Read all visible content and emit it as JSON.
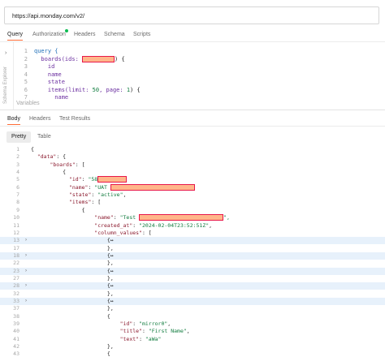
{
  "url": "https://api.monday.com/v2/",
  "request_tabs": [
    "Query",
    "Authorization",
    "Headers",
    "Schema",
    "Scripts"
  ],
  "schema_explorer_label": "Schema Explorer",
  "query": {
    "lines": [
      {
        "n": "1",
        "parts": [
          {
            "t": "query {",
            "c": "kw"
          }
        ]
      },
      {
        "n": "2",
        "parts": [
          {
            "t": "  boards(ids: ",
            "c": "fld"
          },
          {
            "t": "",
            "c": "redact",
            "w": 40
          },
          {
            "t": ") {",
            "c": "pun"
          }
        ]
      },
      {
        "n": "3",
        "parts": [
          {
            "t": "    id",
            "c": "fld"
          }
        ]
      },
      {
        "n": "4",
        "parts": [
          {
            "t": "    name",
            "c": "fld"
          }
        ]
      },
      {
        "n": "5",
        "parts": [
          {
            "t": "    state",
            "c": "fld"
          }
        ]
      },
      {
        "n": "6",
        "parts": [
          {
            "t": "    items(limit: ",
            "c": "fld"
          },
          {
            "t": "50",
            "c": "num"
          },
          {
            "t": ", page: ",
            "c": "fld"
          },
          {
            "t": "1",
            "c": "num"
          },
          {
            "t": ") {",
            "c": "pun"
          }
        ]
      },
      {
        "n": "7",
        "parts": [
          {
            "t": "      name",
            "c": "fld"
          }
        ]
      }
    ],
    "variables_label": "Variables"
  },
  "response_tabs": [
    "Body",
    "Headers",
    "Test Results"
  ],
  "view_tabs": [
    "Pretty",
    "Table"
  ],
  "response": {
    "rows": [
      {
        "n": "1",
        "a": "",
        "hl": false,
        "parts": [
          {
            "t": "{",
            "c": "pun"
          }
        ]
      },
      {
        "n": "2",
        "a": "",
        "hl": false,
        "parts": [
          {
            "t": "  ",
            "c": "pun"
          },
          {
            "t": "\"data\"",
            "c": "key"
          },
          {
            "t": ": {",
            "c": "pun"
          }
        ]
      },
      {
        "n": "3",
        "a": "",
        "hl": false,
        "parts": [
          {
            "t": "      ",
            "c": "pun"
          },
          {
            "t": "\"boards\"",
            "c": "key"
          },
          {
            "t": ": [",
            "c": "pun"
          }
        ]
      },
      {
        "n": "4",
        "a": "",
        "hl": false,
        "parts": [
          {
            "t": "          {",
            "c": "pun"
          }
        ]
      },
      {
        "n": "5",
        "a": "",
        "hl": false,
        "parts": [
          {
            "t": "            ",
            "c": "pun"
          },
          {
            "t": "\"id\"",
            "c": "key"
          },
          {
            "t": ": ",
            "c": "pun"
          },
          {
            "t": "\"58",
            "c": "str"
          },
          {
            "t": "",
            "c": "redact",
            "w": 36
          }
        ]
      },
      {
        "n": "6",
        "a": "",
        "hl": false,
        "parts": [
          {
            "t": "            ",
            "c": "pun"
          },
          {
            "t": "\"name\"",
            "c": "key"
          },
          {
            "t": ": ",
            "c": "pun"
          },
          {
            "t": "\"UAT",
            "c": "str"
          },
          {
            "t": " ",
            "c": "pun"
          },
          {
            "t": "",
            "c": "redact",
            "w": 104
          }
        ]
      },
      {
        "n": "7",
        "a": "",
        "hl": false,
        "parts": [
          {
            "t": "            ",
            "c": "pun"
          },
          {
            "t": "\"state\"",
            "c": "key"
          },
          {
            "t": ": ",
            "c": "pun"
          },
          {
            "t": "\"active\"",
            "c": "str"
          },
          {
            "t": ",",
            "c": "pun"
          }
        ]
      },
      {
        "n": "8",
        "a": "",
        "hl": false,
        "parts": [
          {
            "t": "            ",
            "c": "pun"
          },
          {
            "t": "\"items\"",
            "c": "key"
          },
          {
            "t": ": [",
            "c": "pun"
          }
        ]
      },
      {
        "n": "9",
        "a": "",
        "hl": false,
        "parts": [
          {
            "t": "                {",
            "c": "pun"
          }
        ]
      },
      {
        "n": "10",
        "a": "",
        "hl": false,
        "parts": [
          {
            "t": "                    ",
            "c": "pun"
          },
          {
            "t": "\"name\"",
            "c": "key"
          },
          {
            "t": ": ",
            "c": "pun"
          },
          {
            "t": "\"Test ",
            "c": "str"
          },
          {
            "t": "",
            "c": "redact",
            "w": 104
          },
          {
            "t": "\",",
            "c": "str"
          }
        ]
      },
      {
        "n": "11",
        "a": "",
        "hl": false,
        "parts": [
          {
            "t": "                    ",
            "c": "pun"
          },
          {
            "t": "\"created_at\"",
            "c": "key"
          },
          {
            "t": ": ",
            "c": "pun"
          },
          {
            "t": "\"2024-02-04T23:52:51Z\"",
            "c": "str"
          },
          {
            "t": ",",
            "c": "pun"
          }
        ]
      },
      {
        "n": "12",
        "a": "",
        "hl": false,
        "parts": [
          {
            "t": "                    ",
            "c": "pun"
          },
          {
            "t": "\"column_values\"",
            "c": "key"
          },
          {
            "t": ": [",
            "c": "pun"
          }
        ]
      },
      {
        "n": "13",
        "a": "›",
        "hl": true,
        "parts": [
          {
            "t": "                        {↔",
            "c": "pun"
          }
        ]
      },
      {
        "n": "17",
        "a": "",
        "hl": false,
        "parts": [
          {
            "t": "                        },",
            "c": "pun"
          }
        ]
      },
      {
        "n": "18",
        "a": "›",
        "hl": true,
        "parts": [
          {
            "t": "                        {↔",
            "c": "pun"
          }
        ]
      },
      {
        "n": "22",
        "a": "",
        "hl": false,
        "parts": [
          {
            "t": "                        },",
            "c": "pun"
          }
        ]
      },
      {
        "n": "23",
        "a": "›",
        "hl": true,
        "parts": [
          {
            "t": "                        {↔",
            "c": "pun"
          }
        ]
      },
      {
        "n": "27",
        "a": "",
        "hl": false,
        "parts": [
          {
            "t": "                        },",
            "c": "pun"
          }
        ]
      },
      {
        "n": "28",
        "a": "›",
        "hl": true,
        "parts": [
          {
            "t": "                        {↔",
            "c": "pun"
          }
        ]
      },
      {
        "n": "32",
        "a": "",
        "hl": false,
        "parts": [
          {
            "t": "                        },",
            "c": "pun"
          }
        ]
      },
      {
        "n": "33",
        "a": "›",
        "hl": true,
        "parts": [
          {
            "t": "                        {↔",
            "c": "pun"
          }
        ]
      },
      {
        "n": "37",
        "a": "",
        "hl": false,
        "parts": [
          {
            "t": "                        },",
            "c": "pun"
          }
        ]
      },
      {
        "n": "38",
        "a": "",
        "hl": false,
        "parts": [
          {
            "t": "                        {",
            "c": "pun"
          }
        ]
      },
      {
        "n": "39",
        "a": "",
        "hl": false,
        "parts": [
          {
            "t": "                            ",
            "c": "pun"
          },
          {
            "t": "\"id\"",
            "c": "key"
          },
          {
            "t": ": ",
            "c": "pun"
          },
          {
            "t": "\"mirror0\"",
            "c": "str"
          },
          {
            "t": ",",
            "c": "pun"
          }
        ]
      },
      {
        "n": "40",
        "a": "",
        "hl": false,
        "parts": [
          {
            "t": "                            ",
            "c": "pun"
          },
          {
            "t": "\"title\"",
            "c": "key"
          },
          {
            "t": ": ",
            "c": "pun"
          },
          {
            "t": "\"First Name\"",
            "c": "str"
          },
          {
            "t": ",",
            "c": "pun"
          }
        ]
      },
      {
        "n": "41",
        "a": "",
        "hl": false,
        "parts": [
          {
            "t": "                            ",
            "c": "pun"
          },
          {
            "t": "\"text\"",
            "c": "key"
          },
          {
            "t": ": ",
            "c": "pun"
          },
          {
            "t": "\"aWa\"",
            "c": "str"
          }
        ]
      },
      {
        "n": "42",
        "a": "",
        "hl": false,
        "parts": [
          {
            "t": "                        },",
            "c": "pun"
          }
        ]
      },
      {
        "n": "43",
        "a": "",
        "hl": false,
        "parts": [
          {
            "t": "                        {",
            "c": "pun"
          }
        ]
      }
    ]
  }
}
